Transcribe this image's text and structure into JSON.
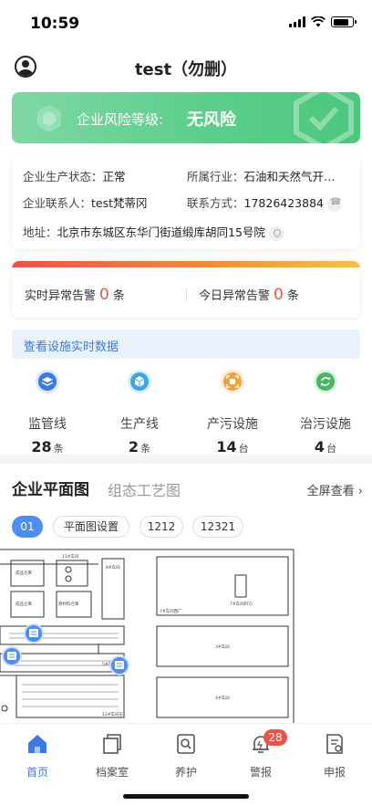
{
  "status_bar": {
    "time": "10:59"
  },
  "header": {
    "title": "test（勿删）"
  },
  "risk": {
    "label": "企业风险等级:",
    "value": "无风险",
    "colors": {
      "start": "#7fd8a5",
      "end": "#4cc77d"
    }
  },
  "info": {
    "production_status_label": "企业生产状态：",
    "production_status_value": "正常",
    "industry_label": "所属行业：",
    "industry_value": "石油和天然气开…",
    "contact_label": "企业联系人：",
    "contact_value": "test梵蒂冈",
    "phone_label": "联系方式：",
    "phone_value": "17826423884",
    "address_label": "地址：",
    "address_value": "北京市东城区东华门街道缎库胡同15号院"
  },
  "alarms": {
    "realtime_label": "实时异常告警",
    "realtime_count": "0",
    "today_label": "今日异常告警",
    "today_count": "0",
    "unit": "条"
  },
  "view_link": {
    "label": "查看设施实时数据"
  },
  "stats": [
    {
      "label": "监管线",
      "value": "28",
      "unit": "条",
      "icon": "layers-icon",
      "color": "#3d7ae0"
    },
    {
      "label": "生产线",
      "value": "2",
      "unit": "条",
      "icon": "cube-icon",
      "color": "#3aa7e8"
    },
    {
      "label": "产污设施",
      "value": "14",
      "unit": "台",
      "icon": "scan-icon",
      "color": "#f0a33a"
    },
    {
      "label": "治污设施",
      "value": "4",
      "unit": "台",
      "icon": "recycle-icon",
      "color": "#45b863"
    }
  ],
  "plan": {
    "tab_active": "企业平面图",
    "tab_inactive": "组态工艺图",
    "fullscreen_label": "全屏查看",
    "chips": [
      "01",
      "平面图设置",
      "1212",
      "12321"
    ],
    "rooms": [
      "成品仓库",
      "原材料仓库",
      "11#车间",
      "8#车间",
      "7#车间RTO",
      "7#车间西厂",
      "3#车间",
      "4#车间",
      "5#车间",
      "12#车间东"
    ]
  },
  "tabbar": {
    "items": [
      {
        "label": "首页",
        "icon": "home-icon"
      },
      {
        "label": "档案室",
        "icon": "archive-icon"
      },
      {
        "label": "养护",
        "icon": "maintenance-icon"
      },
      {
        "label": "警报",
        "icon": "alarm-bell-icon",
        "badge": "28"
      },
      {
        "label": "申报",
        "icon": "report-icon"
      }
    ]
  }
}
